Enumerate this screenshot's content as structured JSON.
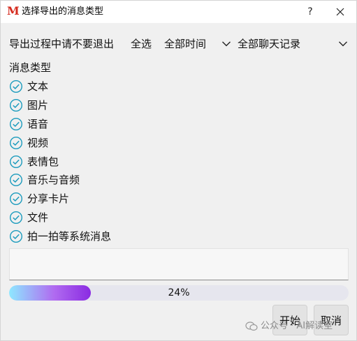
{
  "window": {
    "logo_letter": "M",
    "title": "选择导出的消息类型",
    "help_label": "?",
    "close_icon": "close-icon"
  },
  "toolbar": {
    "warning": "导出过程中请不要退出",
    "select_all": "全选",
    "time_range": "全部时间",
    "chat_scope": "全部聊天记录"
  },
  "types_label": "消息类型",
  "message_types": [
    {
      "label": "文本",
      "checked": true
    },
    {
      "label": "图片",
      "checked": true
    },
    {
      "label": "语音",
      "checked": true
    },
    {
      "label": "视频",
      "checked": true
    },
    {
      "label": "表情包",
      "checked": true
    },
    {
      "label": "音乐与音频",
      "checked": true
    },
    {
      "label": "分享卡片",
      "checked": true
    },
    {
      "label": "文件",
      "checked": true
    },
    {
      "label": "拍一拍等系统消息",
      "checked": true
    }
  ],
  "log_text": "",
  "progress": {
    "value": 0.24,
    "label": "24%"
  },
  "buttons": {
    "start": "开始",
    "cancel": "取消"
  },
  "watermark": "公众号 · AI解读室",
  "colors": {
    "accent": "#1b9bbd",
    "logo": "#d52b1e",
    "progress_start": "#8ee8ff",
    "progress_end": "#8a2be2"
  }
}
